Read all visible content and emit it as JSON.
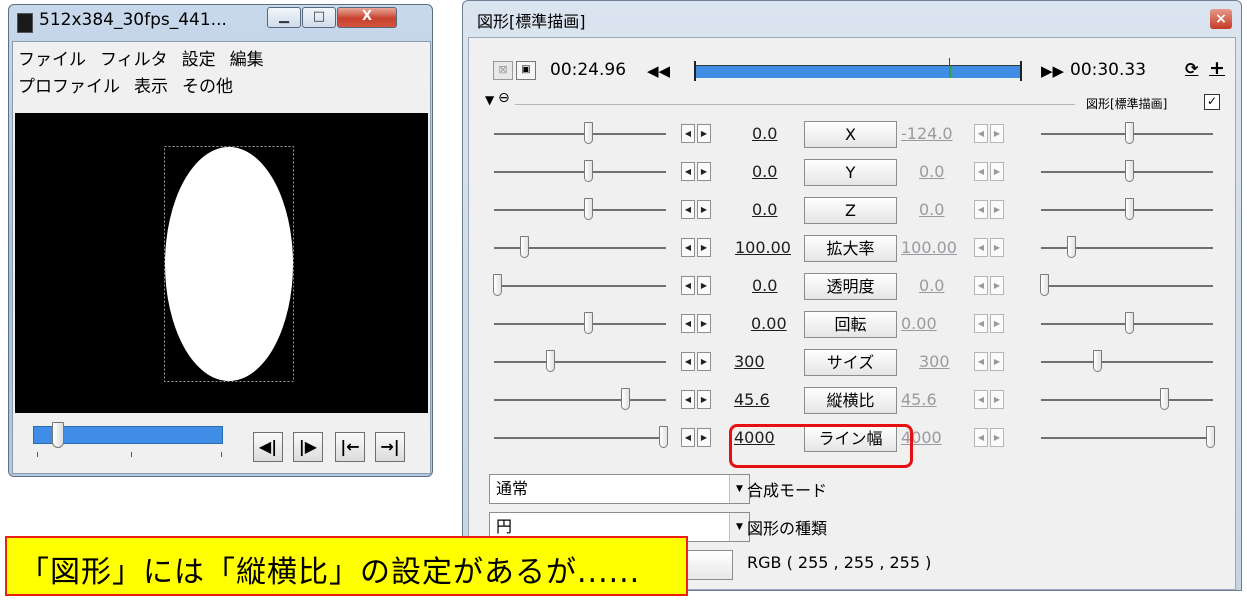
{
  "preview_window": {
    "title": "512x384_30fps_441...",
    "caption_buttons": {
      "minimize": "▁",
      "maximize": "□",
      "close": "X"
    },
    "menu_row1": [
      "ファイル",
      "フィルタ",
      "設定",
      "編集"
    ],
    "menu_row2": [
      "プロファイル",
      "表示",
      "その他"
    ],
    "playback_position": 0.13,
    "nav_buttons": [
      {
        "name": "prev-frame-button",
        "label": "◀|"
      },
      {
        "name": "next-frame-button",
        "label": "|▶"
      },
      {
        "name": "jump-start-button",
        "label": "|←"
      },
      {
        "name": "jump-end-button",
        "label": "→|"
      }
    ]
  },
  "settings_window": {
    "title": "図形[標準描画]",
    "close_label": "×",
    "time_start": "00:24.96",
    "time_end": "00:30.33",
    "timeline_marker": 0.78,
    "section_label": "図形[標準描画]",
    "section_checked": true,
    "params": [
      {
        "name": "X",
        "left": "0.0",
        "right": "-124.0",
        "left_pos": 0.55,
        "right_pos": 0.51
      },
      {
        "name": "Y",
        "left": "0.0",
        "right": "0.0",
        "left_pos": 0.55,
        "right_pos": 0.51
      },
      {
        "name": "Z",
        "left": "0.0",
        "right": "0.0",
        "left_pos": 0.55,
        "right_pos": 0.51
      },
      {
        "name": "拡大率",
        "left": "100.00",
        "right": "100.00",
        "left_pos": 0.16,
        "right_pos": 0.16
      },
      {
        "name": "透明度",
        "left": "0.0",
        "right": "0.0",
        "left_pos": 0.0,
        "right_pos": 0.0
      },
      {
        "name": "回転",
        "left": "0.00",
        "right": "0.00",
        "left_pos": 0.55,
        "right_pos": 0.51
      },
      {
        "name": "サイズ",
        "left": "300",
        "right": "300",
        "left_pos": 0.32,
        "right_pos": 0.32
      },
      {
        "name": "縦横比",
        "left": "45.6",
        "right": "45.6",
        "left_pos": 0.77,
        "right_pos": 0.72
      },
      {
        "name": "ライン幅",
        "left": "4000",
        "right": "4000",
        "left_pos": 1.0,
        "right_pos": 1.0
      }
    ],
    "highlighted_param": "縦横比",
    "blend_mode": {
      "value": "通常",
      "label": "合成モード"
    },
    "shape_type": {
      "value": "円",
      "label": "図形の種類"
    },
    "color_label": "RGB ( 255 , 255 , 255 )"
  },
  "annotation": {
    "text": "「図形」には「縦横比」の設定があるが......",
    "bg_color": "#ffff00",
    "border_color": "#e8220f"
  },
  "colors": {
    "timeline_fill": "#3f8de4",
    "highlight": "#e60f12"
  }
}
